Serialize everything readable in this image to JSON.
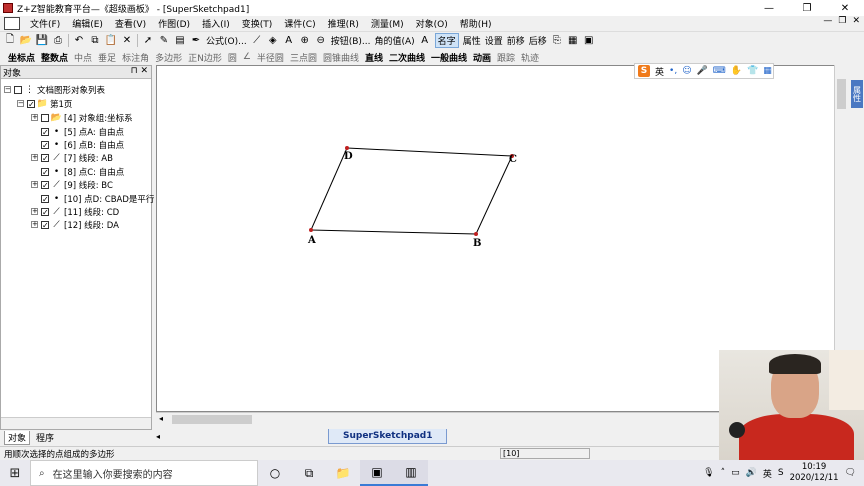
{
  "window": {
    "title": "Z+Z智能教育平台—《超级画板》 - [SuperSketchpad1]",
    "controls": [
      "—",
      "❐",
      "✕"
    ]
  },
  "menubar": {
    "items": [
      "文件(F)",
      "编辑(E)",
      "查看(V)",
      "作图(D)",
      "插入(I)",
      "变换(T)",
      "课件(C)",
      "推理(R)",
      "测量(M)",
      "对象(O)",
      "帮助(H)"
    ],
    "mdi_controls": [
      "—",
      "❐",
      "✕"
    ]
  },
  "toolbar1": {
    "formula_label": "公式(O)...",
    "button_label": "按钮(B)...",
    "angle_label": "角的值(A)",
    "name_label": "名字",
    "attr_label": "属性",
    "settings_label": "设置",
    "forward_label": "前移",
    "back_label": "后移"
  },
  "toolbar2": {
    "items": [
      {
        "label": "坐标点",
        "style": "bold"
      },
      {
        "label": "整数点",
        "style": "bold"
      },
      {
        "label": "中点",
        "style": "dim"
      },
      {
        "label": "垂足",
        "style": "dim"
      },
      {
        "label": "标注角",
        "style": "dim"
      },
      {
        "label": "多边形",
        "style": "dim"
      },
      {
        "label": "正N边形",
        "style": "dim"
      },
      {
        "label": "圆",
        "style": "dim"
      },
      {
        "label": "∠",
        "style": "dim"
      },
      {
        "label": "半径圆",
        "style": "dim"
      },
      {
        "label": "三点圆",
        "style": "dim"
      },
      {
        "label": "圆锥曲线",
        "style": "dim"
      },
      {
        "label": "直线",
        "style": "bold"
      },
      {
        "label": "二次曲线",
        "style": "bold"
      },
      {
        "label": "一般曲线",
        "style": "bold"
      },
      {
        "label": "动画",
        "style": "bold"
      },
      {
        "label": "跟踪",
        "style": "dim"
      },
      {
        "label": "轨迹",
        "style": "dim"
      }
    ]
  },
  "object_panel": {
    "title": "对象",
    "header_controls": "⊓ ✕",
    "root": "文档图形对象列表",
    "page": "第1页",
    "items": [
      "[4] 对象组:坐标系",
      "[5] 点A: 自由点",
      "[6] 点B: 自由点",
      "[7] 线段: AB",
      "[8] 点C: 自由点",
      "[9] 线段: BC",
      "[10] 点D: CBAD是平行",
      "[11] 线段: CD",
      "[12] 线段: DA"
    ],
    "tabs": [
      "对象",
      "程序"
    ]
  },
  "canvas": {
    "points": [
      {
        "label": "A"
      },
      {
        "label": "B"
      },
      {
        "label": "C"
      },
      {
        "label": "D"
      }
    ],
    "color_point": "#c02020",
    "color_segment": "#000000"
  },
  "side_tab": "属性",
  "doc_tab": "SuperSketchpad1",
  "statusbar": {
    "message": "用顺次选择的点组成的多边形",
    "coord": "[10]"
  },
  "ime": {
    "logo": "S",
    "lang": "英"
  },
  "taskbar": {
    "search_placeholder": "在这里输入你要搜索的内容",
    "time": "10:19",
    "date": "2020/12/11"
  }
}
